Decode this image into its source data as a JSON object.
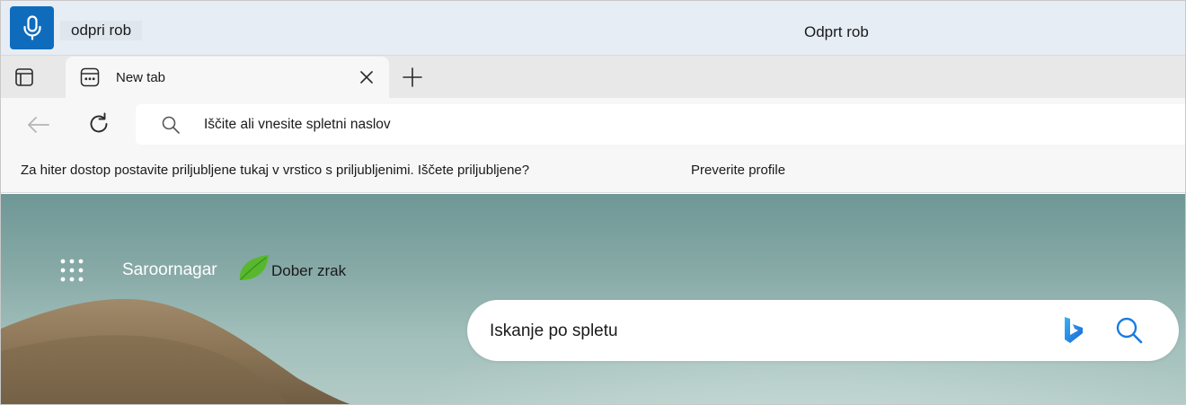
{
  "voice_access": {
    "heard_text": "odpri rob",
    "result_text": "Odprt rob",
    "mic_icon": "microphone-icon",
    "accent_color": "#0f6cbd"
  },
  "tabs": [
    {
      "title": "New tab",
      "icon": "new-tab-page-icon",
      "active": true
    }
  ],
  "toolbar": {
    "address_placeholder": "Iščite ali vnesite spletni naslov"
  },
  "favorites_bar": {
    "message": "Za hiter dostop postavite priljubljene tukaj v vrstico s priljubljenimi. Iščete priljubljene?",
    "link": "Preverite profile"
  },
  "new_tab_page": {
    "location": "Saroornagar",
    "air_quality": "Dober zrak",
    "air_quality_icon": "leaf-icon",
    "search_placeholder": "Iskanje po spletu",
    "search_engine_icon": "bing-icon",
    "air_quality_color": "#58b82d"
  }
}
